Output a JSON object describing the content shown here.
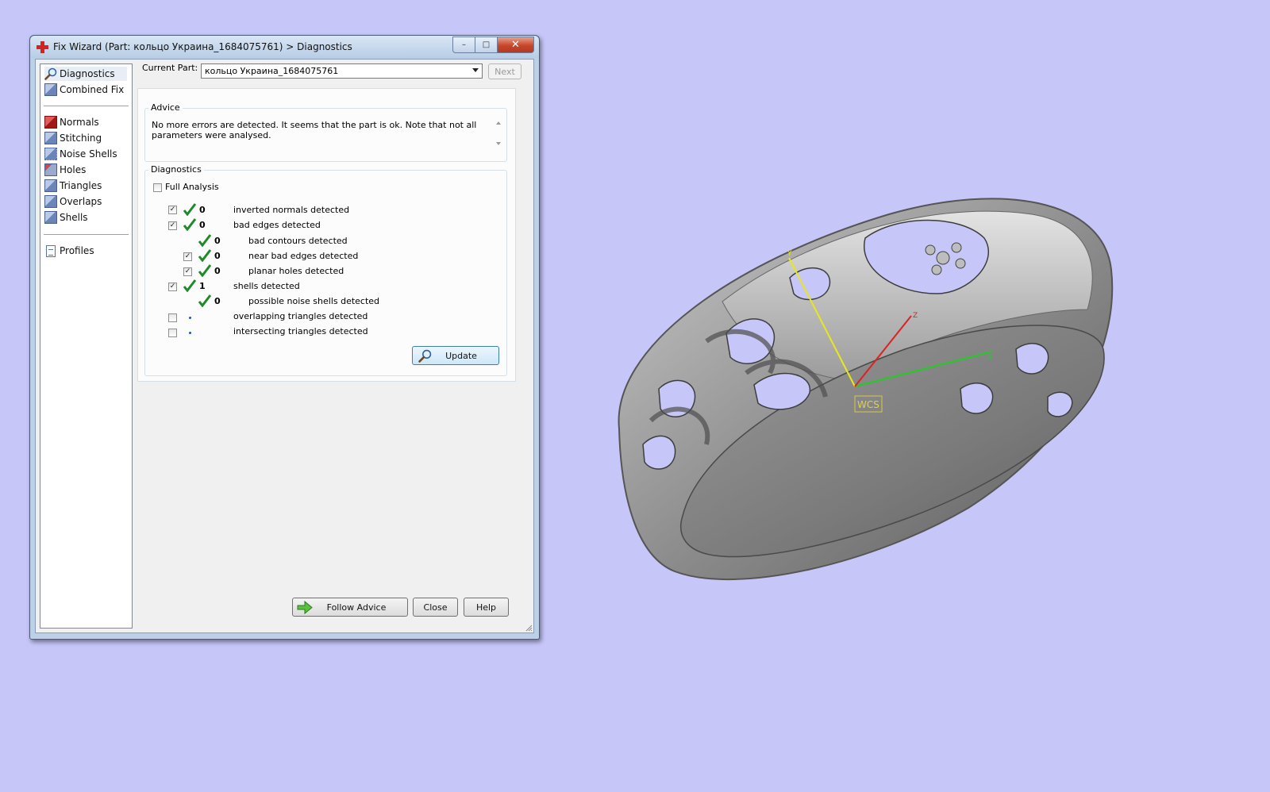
{
  "window": {
    "title": "Fix Wizard (Part: кольцо Украина_1684075761) > Diagnostics",
    "close_symbol": "✕",
    "maximize_symbol": "□",
    "minimize_symbol": "–"
  },
  "nav": {
    "items": [
      {
        "label": "Diagnostics",
        "icon": "magnifier-icon"
      },
      {
        "label": "Combined Fix",
        "icon": "combined-fix-icon"
      },
      {
        "label": "Normals",
        "icon": "normals-icon"
      },
      {
        "label": "Stitching",
        "icon": "stitching-icon"
      },
      {
        "label": "Noise Shells",
        "icon": "noise-shells-icon"
      },
      {
        "label": "Holes",
        "icon": "holes-icon"
      },
      {
        "label": "Triangles",
        "icon": "triangles-icon"
      },
      {
        "label": "Overlaps",
        "icon": "overlaps-icon"
      },
      {
        "label": "Shells",
        "icon": "shells-icon"
      },
      {
        "label": "Profiles",
        "icon": "profiles-icon"
      }
    ],
    "selected": "Diagnostics"
  },
  "header": {
    "current_part_label": "Current Part:",
    "current_part_value": "кольцо Украина_1684075761",
    "next_label": "Next"
  },
  "advice": {
    "title": "Advice",
    "text": "No more errors are detected. It seems that the part is ok. Note that not all parameters were analysed."
  },
  "diagnostics": {
    "title": "Diagnostics",
    "full_analysis_label": "Full Analysis",
    "full_analysis_checked": false,
    "rows": [
      {
        "checkbox": true,
        "checked": true,
        "status": "ok",
        "count": "0",
        "label": "inverted normals detected",
        "indent": 0
      },
      {
        "checkbox": true,
        "checked": true,
        "status": "ok",
        "count": "0",
        "label": "bad edges detected",
        "indent": 0
      },
      {
        "checkbox": false,
        "checked": false,
        "status": "ok",
        "count": "0",
        "label": "bad contours detected",
        "indent": 1
      },
      {
        "checkbox": true,
        "checked": true,
        "status": "ok",
        "count": "0",
        "label": "near bad edges detected",
        "indent": 1
      },
      {
        "checkbox": true,
        "checked": true,
        "status": "ok",
        "count": "0",
        "label": "planar holes detected",
        "indent": 1
      },
      {
        "checkbox": true,
        "checked": true,
        "status": "ok",
        "count": "1",
        "label": "shells detected",
        "indent": 0
      },
      {
        "checkbox": false,
        "checked": false,
        "status": "ok",
        "count": "0",
        "label": "possible noise shells detected",
        "indent": 1
      },
      {
        "checkbox": true,
        "checked": false,
        "status": "pending",
        "count": "",
        "label": "overlapping triangles detected",
        "indent": 0
      },
      {
        "checkbox": true,
        "checked": false,
        "status": "pending",
        "count": "",
        "label": "intersecting triangles detected",
        "indent": 0
      }
    ],
    "update_label": "Update"
  },
  "footer": {
    "follow_advice_label": "Follow Advice",
    "close_label": "Close",
    "help_label": "Help"
  },
  "viewport": {
    "wcs_label": "WCS",
    "axis_x": "X",
    "axis_y": "Y",
    "axis_z": "Z",
    "colors": {
      "x_axis": "#22cc22",
      "y_axis": "#e8e818",
      "z_axis": "#dd2222",
      "background": "#c6c6f9",
      "model": "#8c8c8c"
    }
  }
}
